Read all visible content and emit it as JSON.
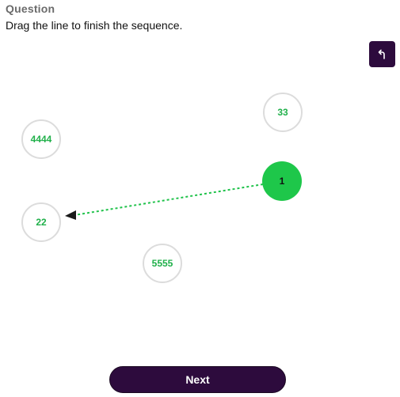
{
  "header": {
    "heading": "Question",
    "prompt": "Drag the line to finish the sequence."
  },
  "toolbar": {
    "undo_icon": "undo-arrow-icon"
  },
  "nodes": [
    {
      "id": "node-33",
      "label": "33",
      "state": "inactive"
    },
    {
      "id": "node-4444",
      "label": "4444",
      "state": "inactive"
    },
    {
      "id": "node-1",
      "label": "1",
      "state": "active"
    },
    {
      "id": "node-22",
      "label": "22",
      "state": "inactive"
    },
    {
      "id": "node-5555",
      "label": "5555",
      "state": "inactive"
    }
  ],
  "connection": {
    "from": "1",
    "to": "22",
    "style": "dashed-arrow"
  },
  "footer": {
    "next_label": "Next"
  },
  "colors": {
    "accent_purple": "#2d0b3d",
    "node_green_text": "#20b04a",
    "node_active_fill": "#1ec74a",
    "line_green": "#1fc24a",
    "node_border": "#dcdcdc",
    "heading_gray": "#6b6b6b"
  }
}
